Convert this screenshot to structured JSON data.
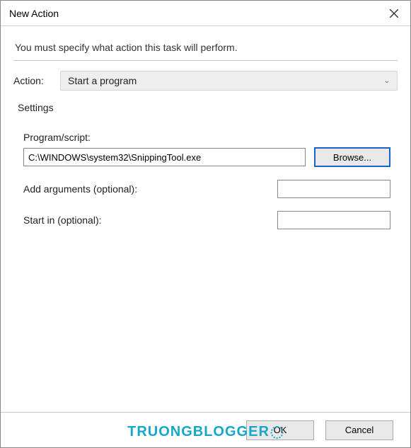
{
  "titlebar": {
    "title": "New Action"
  },
  "instruction": "You must specify what action this task will perform.",
  "action": {
    "label": "Action:",
    "selected": "Start a program"
  },
  "settings": {
    "group_label": "Settings",
    "program_script_label": "Program/script:",
    "program_script_value": "C:\\WINDOWS\\system32\\SnippingTool.exe",
    "browse_label": "Browse...",
    "add_args_label": "Add arguments (optional):",
    "add_args_value": "",
    "start_in_label": "Start in (optional):",
    "start_in_value": ""
  },
  "footer": {
    "ok_label": "OK",
    "cancel_label": "Cancel"
  },
  "watermark": "TRUONGBLOGGER"
}
